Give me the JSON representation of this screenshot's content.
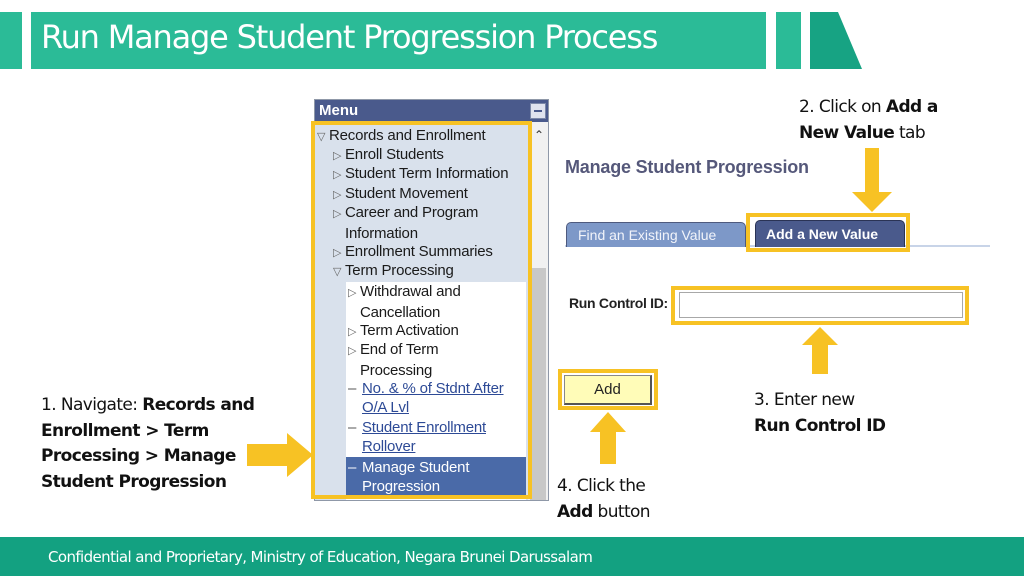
{
  "slide": {
    "title": "Run Manage Student Progression Process",
    "footer": "Confidential and Proprietary, Ministry of Education, Negara Brunei Darussalam"
  },
  "colors": {
    "brand_teal": "#2bbb97",
    "footer_teal": "#13a181",
    "highlight_yellow": "#f7c224",
    "menu_header": "#4a5a8c",
    "selected_item": "#4a6aa8"
  },
  "menu": {
    "title": "Menu",
    "collapse_icon": "minus-icon",
    "items": [
      {
        "label": "Records and Enrollment",
        "icon": "triangle-down-icon",
        "level": 0
      },
      {
        "label": "Enroll Students",
        "icon": "triangle-right-icon",
        "level": 1
      },
      {
        "label": "Student Term Information",
        "icon": "triangle-right-icon",
        "level": 1
      },
      {
        "label": "Student Movement",
        "icon": "triangle-right-icon",
        "level": 1
      },
      {
        "label": "Career and Program",
        "label2": "Information",
        "icon": "triangle-right-icon",
        "level": 1
      },
      {
        "label": "Enrollment Summaries",
        "icon": "triangle-right-icon",
        "level": 1
      },
      {
        "label": "Term Processing",
        "icon": "triangle-down-icon",
        "level": 1
      },
      {
        "label": "Withdrawal and",
        "label2": "Cancellation",
        "icon": "triangle-right-icon",
        "level": 2
      },
      {
        "label": "Term Activation",
        "icon": "triangle-right-icon",
        "level": 2
      },
      {
        "label": "End of Term",
        "label2": "Processing",
        "icon": "triangle-right-icon",
        "level": 2
      },
      {
        "label": "No. & % of Stdnt After",
        "label2": "O/A Lvl",
        "icon": "dash-icon",
        "level": 2,
        "link": true
      },
      {
        "label": "Student Enrollment",
        "label2": "Rollover",
        "icon": "dash-icon",
        "level": 2,
        "link": true
      },
      {
        "label": "Manage Student",
        "label2": "Progression",
        "icon": "dash-icon",
        "level": 2,
        "selected": true
      }
    ]
  },
  "page": {
    "title": "Manage Student Progression",
    "tabs": [
      {
        "label": "Find an Existing Value",
        "active": false
      },
      {
        "label": "Add a New Value",
        "active": true
      }
    ],
    "run_control_label": "Run Control ID:",
    "run_control_value": "",
    "run_control_placeholder": "",
    "add_button": "Add"
  },
  "annotations": {
    "step1": {
      "prefix": "1. Navigate: ",
      "bold": "Records and Enrollment > Term Processing > Manage Student Progression"
    },
    "step1_lines": [
      "Records and",
      "Enrollment > Term",
      "Processing > Manage",
      "Student Progression"
    ],
    "step2": {
      "prefix": "2. Click on ",
      "bold1": "Add a",
      "bold2": "New Value",
      "suffix": " tab"
    },
    "step3": {
      "line1": "3. Enter new",
      "bold": "Run Control ID"
    },
    "step4": {
      "line1": "4. Click the",
      "bold": "Add",
      "suffix": " button"
    }
  }
}
